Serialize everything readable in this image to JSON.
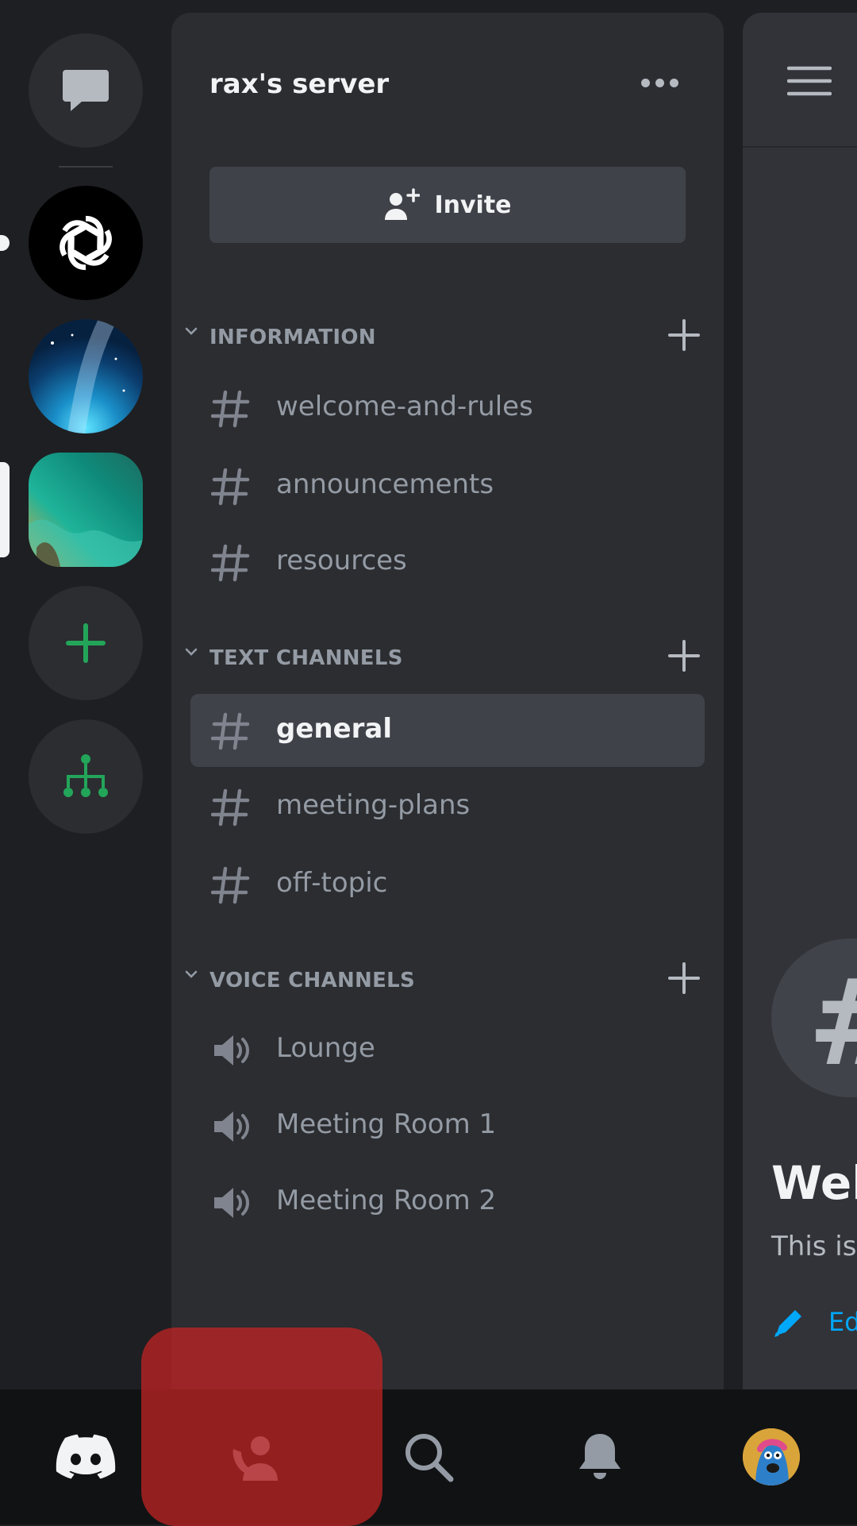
{
  "server": {
    "name": "rax's server",
    "invite_label": "Invite"
  },
  "categories": [
    {
      "label": "INFORMATION"
    },
    {
      "label": "TEXT CHANNELS"
    },
    {
      "label": "VOICE CHANNELS"
    }
  ],
  "channels": {
    "information": [
      {
        "label": "welcome-and-rules",
        "type": "text"
      },
      {
        "label": "announcements",
        "type": "text"
      },
      {
        "label": "resources",
        "type": "text"
      }
    ],
    "text": [
      {
        "label": "general",
        "type": "text",
        "selected": true
      },
      {
        "label": "meeting-plans",
        "type": "text"
      },
      {
        "label": "off-topic",
        "type": "text"
      }
    ],
    "voice": [
      {
        "label": "Lounge",
        "type": "voice"
      },
      {
        "label": "Meeting Room 1",
        "type": "voice"
      },
      {
        "label": "Meeting Room 2",
        "type": "voice"
      }
    ]
  },
  "peek": {
    "title_partial": "Welc",
    "subtitle_partial": "This is",
    "edit_partial": "Ed",
    "hash_glyph": "#"
  },
  "icons": {
    "rail": [
      "direct-messages-icon",
      "openai-server-icon",
      "galaxy-server-icon",
      "ocean-server-icon",
      "add-server-icon",
      "discover-hubs-icon"
    ],
    "nav": [
      "discord-home-icon",
      "friends-icon",
      "search-icon",
      "notifications-bell-icon",
      "user-avatar"
    ]
  },
  "colors": {
    "accent_green": "#23a559",
    "link_blue": "#00a8fc",
    "highlight_red": "#c82424"
  }
}
